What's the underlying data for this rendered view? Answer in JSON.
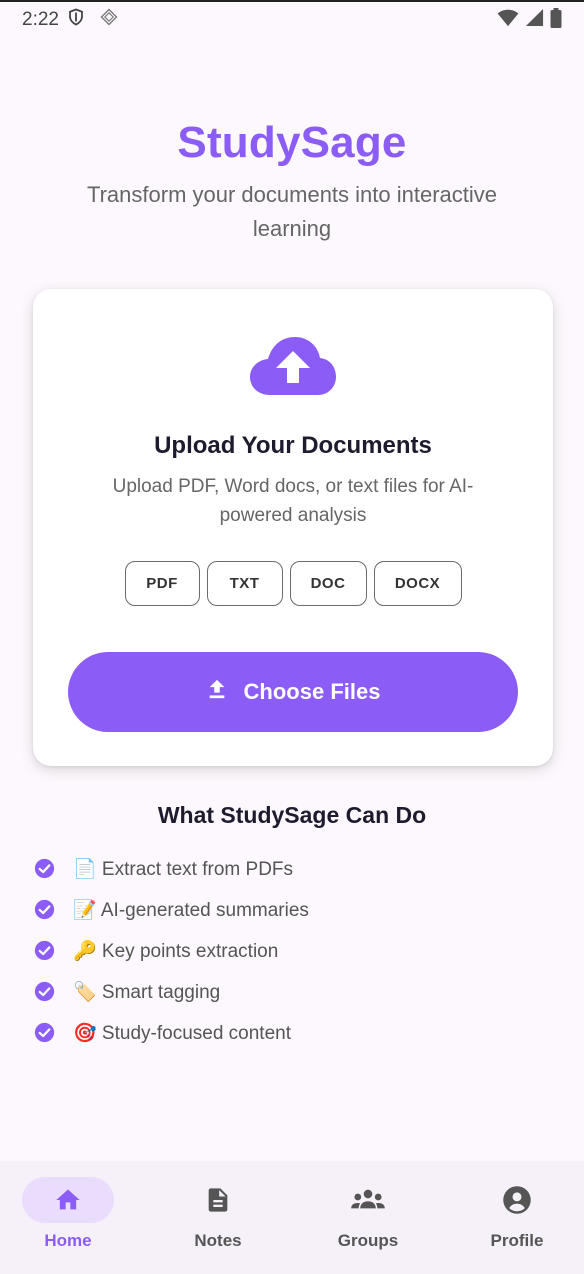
{
  "status_bar": {
    "time": "2:22",
    "icons": [
      "shield-icon",
      "cast-icon",
      "wifi-icon",
      "signal-icon",
      "battery-icon"
    ]
  },
  "app": {
    "title": "StudySage",
    "subtitle": "Transform your documents into interactive learning"
  },
  "upload_card": {
    "icon": "cloud-upload-icon",
    "title": "Upload Your Documents",
    "description": "Upload PDF, Word docs, or text files for AI-powered analysis",
    "file_types": [
      "PDF",
      "TXT",
      "DOC",
      "DOCX"
    ],
    "button_label": "Choose Files"
  },
  "features": {
    "title": "What StudySage Can Do",
    "items": [
      "📄 Extract text from PDFs",
      "📝 AI-generated summaries",
      "🔑 Key points extraction",
      "🏷️ Smart tagging",
      "🎯 Study-focused content"
    ]
  },
  "bottom_nav": {
    "active": "Home",
    "items": [
      {
        "label": "Home",
        "icon": "home-icon"
      },
      {
        "label": "Notes",
        "icon": "document-icon"
      },
      {
        "label": "Groups",
        "icon": "groups-icon"
      },
      {
        "label": "Profile",
        "icon": "account-icon"
      }
    ]
  },
  "colors": {
    "accent": "#8b5cf6",
    "accent_light": "#e9dcfd",
    "background": "#fcf8fd"
  }
}
